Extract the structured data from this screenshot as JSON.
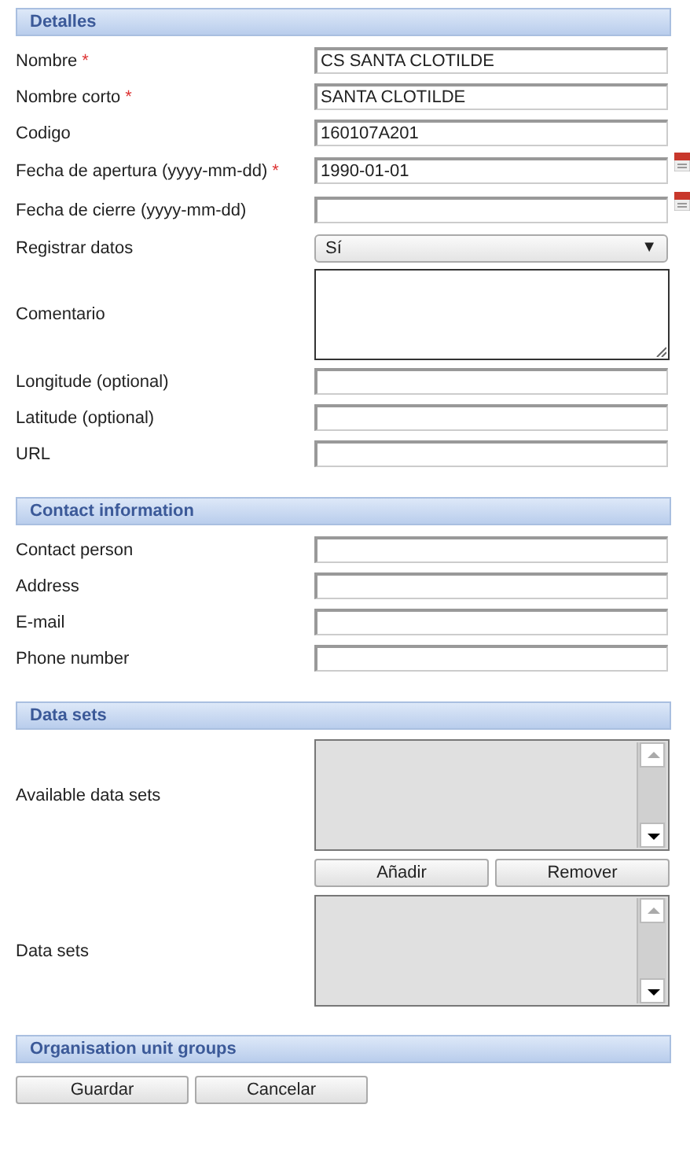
{
  "sections": [
    {
      "title": "Detalles",
      "fields": [
        {
          "label": "Nombre",
          "required": true,
          "kind": "text",
          "value": "CS SANTA CLOTILDE"
        },
        {
          "label": "Nombre corto",
          "required": true,
          "kind": "text",
          "value": "SANTA CLOTILDE"
        },
        {
          "label": "Codigo",
          "required": false,
          "kind": "text",
          "value": "160107A201"
        },
        {
          "label": "Fecha de apertura (yyyy-mm-dd)",
          "required": true,
          "kind": "date",
          "value": "1990-01-01"
        },
        {
          "label": "Fecha de cierre (yyyy-mm-dd)",
          "required": false,
          "kind": "date"
        },
        {
          "label": "Registrar datos",
          "required": false,
          "kind": "select",
          "value": "Sí",
          "caret": "▼"
        },
        {
          "label": "Comentario",
          "required": false,
          "kind": "textarea"
        },
        {
          "label": "Longitude (optional)",
          "required": false,
          "kind": "text"
        },
        {
          "label": "Latitude (optional)",
          "required": false,
          "kind": "text"
        },
        {
          "label": "URL",
          "required": false,
          "kind": "text"
        }
      ]
    },
    {
      "title": "Contact information",
      "fields": [
        {
          "label": "Contact person",
          "required": false,
          "kind": "text"
        },
        {
          "label": "Address",
          "required": false,
          "kind": "text"
        },
        {
          "label": "E-mail",
          "required": false,
          "kind": "text"
        },
        {
          "label": "Phone number",
          "required": false,
          "kind": "text"
        }
      ]
    },
    {
      "title": "Data sets",
      "datasets": {
        "available_label": "Available data sets",
        "buttons": [
          "Añadir",
          "Remover"
        ],
        "selected_label": "Data sets"
      }
    },
    {
      "title": "Organisation unit groups"
    }
  ],
  "required_mark": "*",
  "buttons": [
    "Guardar",
    "Cancelar"
  ]
}
